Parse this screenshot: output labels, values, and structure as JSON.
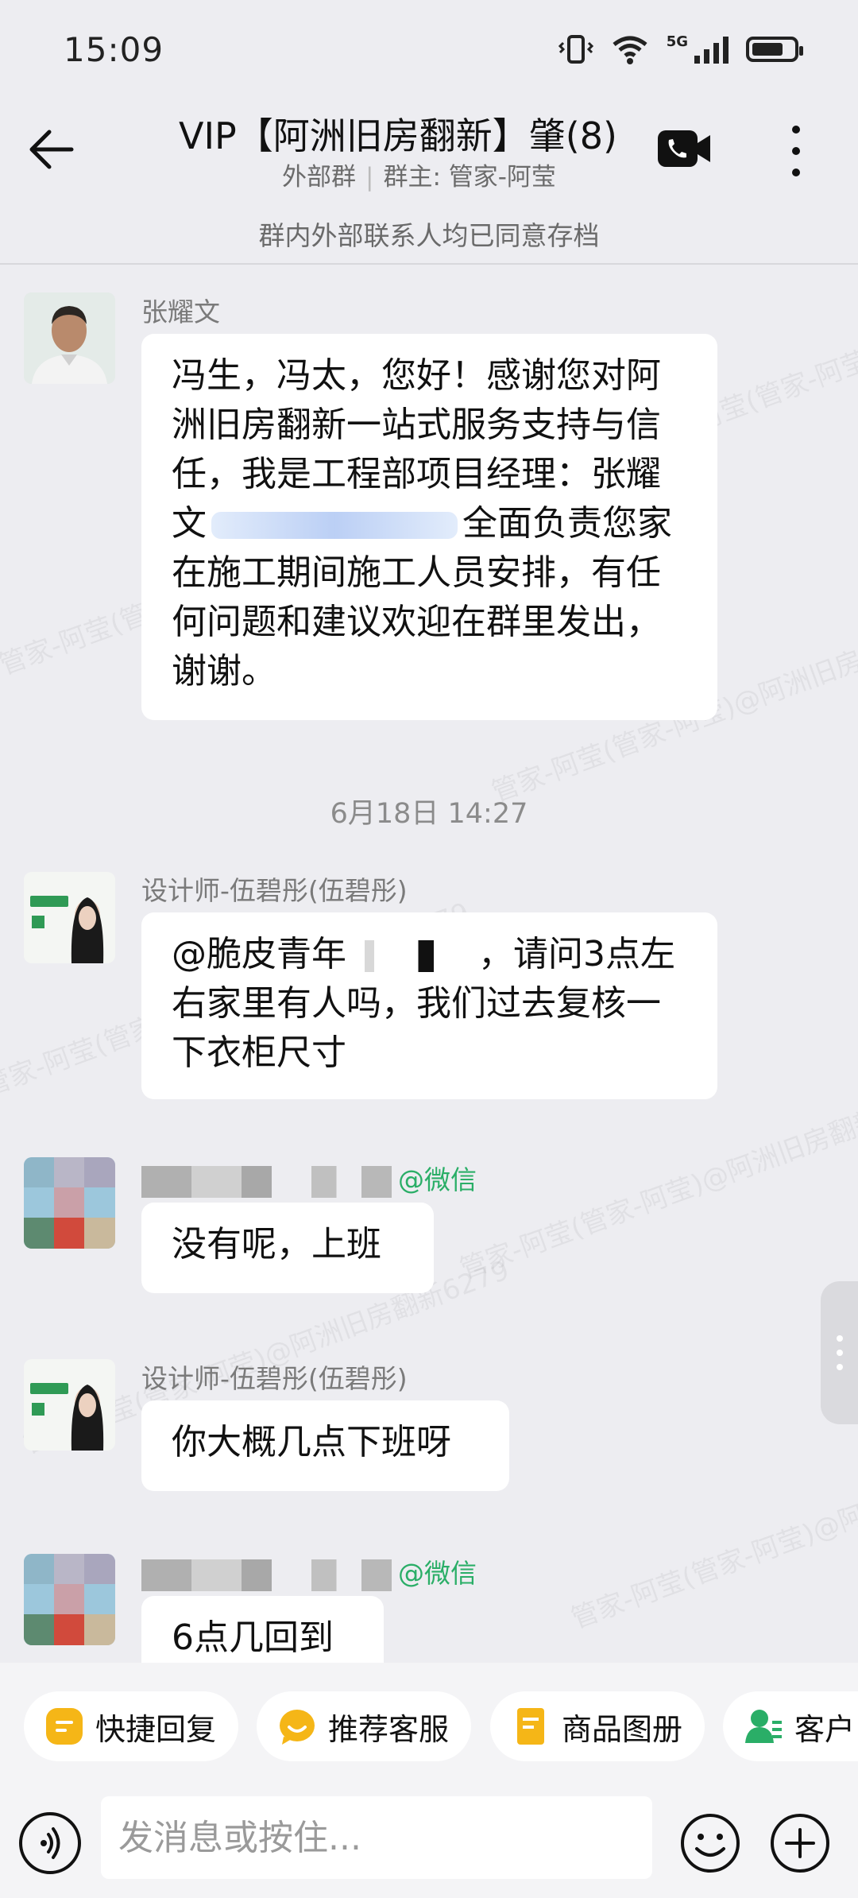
{
  "status_bar": {
    "time": "15:09",
    "network": "5G",
    "battery_percent": 65
  },
  "header": {
    "title": "VIP【阿洲旧房翻新】肇(8)",
    "group_type": "外部群",
    "group_owner": "群主: 管家-阿莹",
    "icons": [
      "back-arrow-icon",
      "video-call-icon",
      "more-vertical-icon"
    ]
  },
  "archive_notice": "群内外部联系人均已同意存档",
  "watermark_text": "管家-阿莹(管家-阿莹)@阿洲旧房翻新6279",
  "messages": [
    {
      "sender": "张耀文",
      "text_before": "冯生，冯太，您好！感谢您对阿洲旧房翻新一站式服务支持与信任，我是工程部项目经理：张耀文",
      "text_after": "全面负责您家在施工期间施工人员安排，有任何问题和建议欢迎在群里发出，谢谢。"
    },
    {
      "sender": "设计师-伍碧彤(伍碧彤)",
      "text_before": "@脆皮青年",
      "text_after": "，请问3点左右家里有人吗，我们过去复核一下衣柜尺寸"
    },
    {
      "sender_tag": "@微信",
      "text": "没有呢，上班"
    },
    {
      "sender": "设计师-伍碧彤(伍碧彤)",
      "text": "你大概几点下班呀"
    },
    {
      "sender_tag": "@微信",
      "text": "6点几回到"
    }
  ],
  "date_divider": "6月18日 14:27",
  "quick_actions": [
    {
      "label": "快捷回复",
      "icon": "quick-reply-icon"
    },
    {
      "label": "推荐客服",
      "icon": "recommend-service-icon"
    },
    {
      "label": "商品图册",
      "icon": "product-catalog-icon"
    },
    {
      "label": "客户",
      "icon": "customer-icon"
    }
  ],
  "input": {
    "placeholder": "发消息或按住..."
  },
  "colors": {
    "background": "#ededf1",
    "bubble": "#ffffff",
    "wechat_green": "#2aae67",
    "chip_yellow": "#f5b617",
    "chip_green": "#2aae67"
  }
}
